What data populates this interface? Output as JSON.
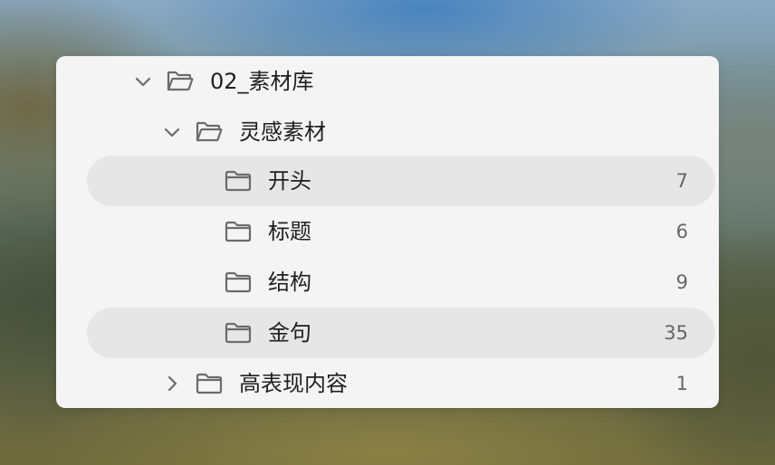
{
  "tree": [
    {
      "label": "02_素材库",
      "count": "",
      "expanded": true,
      "open_folder": true,
      "depth": 0,
      "selected": false,
      "chevron": "chevron-down"
    },
    {
      "label": "灵感素材",
      "count": "",
      "expanded": true,
      "open_folder": true,
      "depth": 1,
      "selected": false,
      "chevron": "chevron-down"
    },
    {
      "label": "开头",
      "count": "7",
      "expanded": false,
      "open_folder": false,
      "depth": 2,
      "selected": true,
      "chevron": ""
    },
    {
      "label": "标题",
      "count": "6",
      "expanded": false,
      "open_folder": false,
      "depth": 2,
      "selected": false,
      "chevron": ""
    },
    {
      "label": "结构",
      "count": "9",
      "expanded": false,
      "open_folder": false,
      "depth": 2,
      "selected": false,
      "chevron": ""
    },
    {
      "label": "金句",
      "count": "35",
      "expanded": false,
      "open_folder": false,
      "depth": 2,
      "selected": true,
      "chevron": ""
    },
    {
      "label": "高表现内容",
      "count": "1",
      "expanded": false,
      "open_folder": false,
      "depth": 1,
      "selected": false,
      "chevron": "chevron-right"
    }
  ],
  "colors": {
    "panel": "#f4f4f5",
    "selected_row": "#e6e6e7",
    "icon": "#6b6b6b",
    "count_text": "#666666"
  },
  "icons": {
    "collapse": "chevron-down-icon",
    "expand": "chevron-right-icon",
    "open_folder": "folder-open-icon",
    "folder": "folder-icon"
  }
}
